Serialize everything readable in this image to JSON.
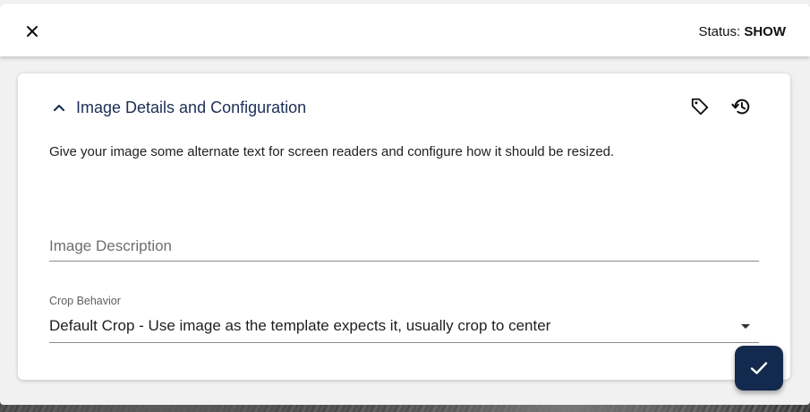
{
  "header": {
    "status_label": "Status:",
    "status_value": "SHOW"
  },
  "card": {
    "title": "Image Details and Configuration",
    "description": "Give your image some alternate text for screen readers and configure how it should be resized."
  },
  "image_description": {
    "placeholder": "Image Description",
    "value": ""
  },
  "crop_behavior": {
    "label": "Crop Behavior",
    "selected": "Default Crop - Use image as the template expects it, usually crop to center"
  },
  "icons": {
    "close": "close-icon",
    "collapse": "chevron-up-icon",
    "tag": "tag-icon",
    "history": "history-icon",
    "dropdown": "dropdown-arrow-icon",
    "confirm": "check-icon"
  },
  "colors": {
    "title": "#1c2f55",
    "fab_background": "#13294d",
    "dialog_background": "#f1f1f1"
  }
}
